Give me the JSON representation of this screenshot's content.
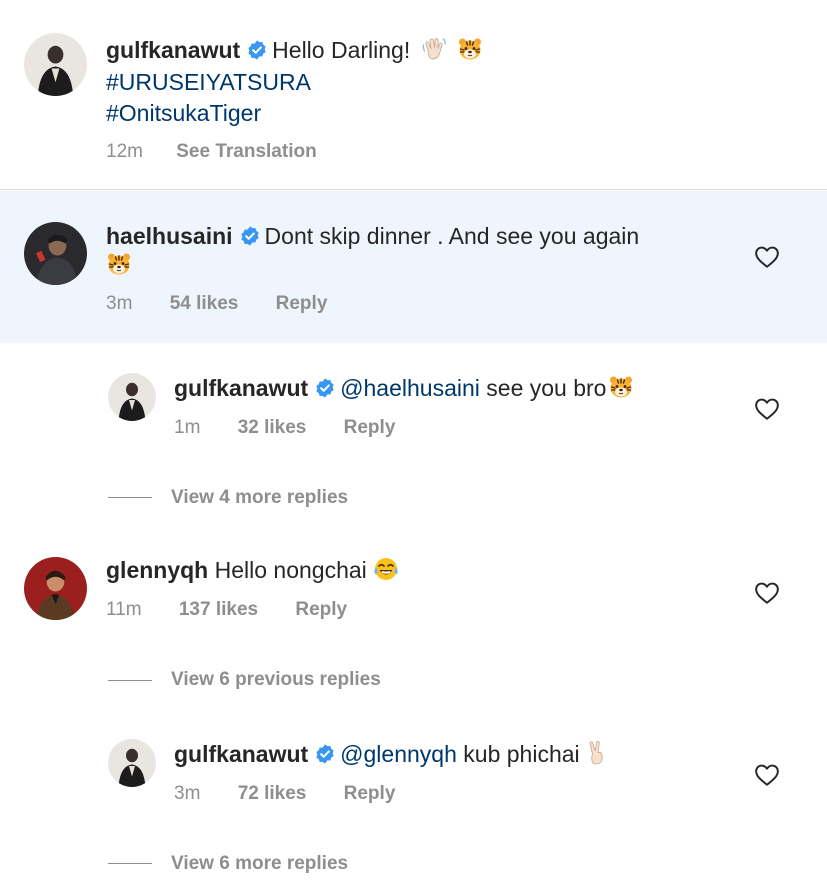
{
  "caption": {
    "username": "gulfkanawut",
    "text": "Hello Darling!",
    "emoji_1": "waving-hand-icon",
    "emoji_2": "tiger-face-icon",
    "hashtag_1": "#URUSEIYATSURA",
    "hashtag_2": "#OnitsukaTiger",
    "time": "12m",
    "translate": "See Translation"
  },
  "comments": [
    {
      "username": "haelhusaini",
      "text": "Dont skip dinner . And see you again",
      "emoji": "tiger-face-icon",
      "time": "3m",
      "likes": "54 likes",
      "reply": "Reply",
      "highlighted": true,
      "replies": [
        {
          "username": "gulfkanawut",
          "mention": "@haelhusaini",
          "text": "see you bro",
          "emoji": "tiger-face-icon",
          "time": "1m",
          "likes": "32 likes",
          "reply": "Reply"
        }
      ],
      "view_more": "View 4 more replies"
    },
    {
      "username": "glennyqh",
      "text": "Hello nongchai",
      "emoji": "tears-of-joy-icon",
      "time": "11m",
      "likes": "137 likes",
      "reply": "Reply",
      "view_previous": "View 6 previous replies",
      "replies": [
        {
          "username": "gulfkanawut",
          "mention": "@glennyqh",
          "text": "kub phichai",
          "emoji": "victory-hand-icon",
          "time": "3m",
          "likes": "72 likes",
          "reply": "Reply"
        }
      ],
      "view_more": "View 6 more replies"
    }
  ],
  "colors": {
    "highlight_bg": "#eef5fc",
    "link": "#00376b",
    "verified": "#3897f0",
    "secondary_text": "#8e8e8e"
  }
}
